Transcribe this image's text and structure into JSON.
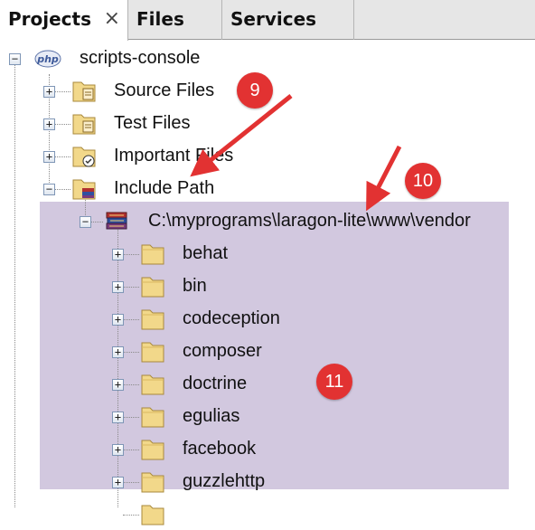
{
  "tabs": [
    {
      "label": "Projects",
      "close": "×"
    },
    {
      "label": "Files"
    },
    {
      "label": "Services"
    }
  ],
  "tree": {
    "project": {
      "icon_text": "php",
      "label": "scripts-console",
      "toggle": "−"
    },
    "nodes": [
      {
        "label": "Source Files",
        "toggle": "+"
      },
      {
        "label": "Test Files",
        "toggle": "+"
      },
      {
        "label": "Important Files",
        "toggle": "+"
      },
      {
        "label": "Include Path",
        "toggle": "−"
      }
    ],
    "library": {
      "label": "C:\\myprograms\\laragon-lite\\www\\vendor",
      "toggle": "−"
    },
    "folders": [
      "behat",
      "bin",
      "codeception",
      "composer",
      "doctrine",
      "egulias",
      "facebook",
      "guzzlehttp"
    ]
  },
  "annotations": {
    "badges": [
      "9",
      "10",
      "11"
    ],
    "color": "#e23232"
  },
  "colors": {
    "selection": "#d2c8df",
    "folder": "#f2d88a",
    "php_icon": "#5b72a8"
  }
}
